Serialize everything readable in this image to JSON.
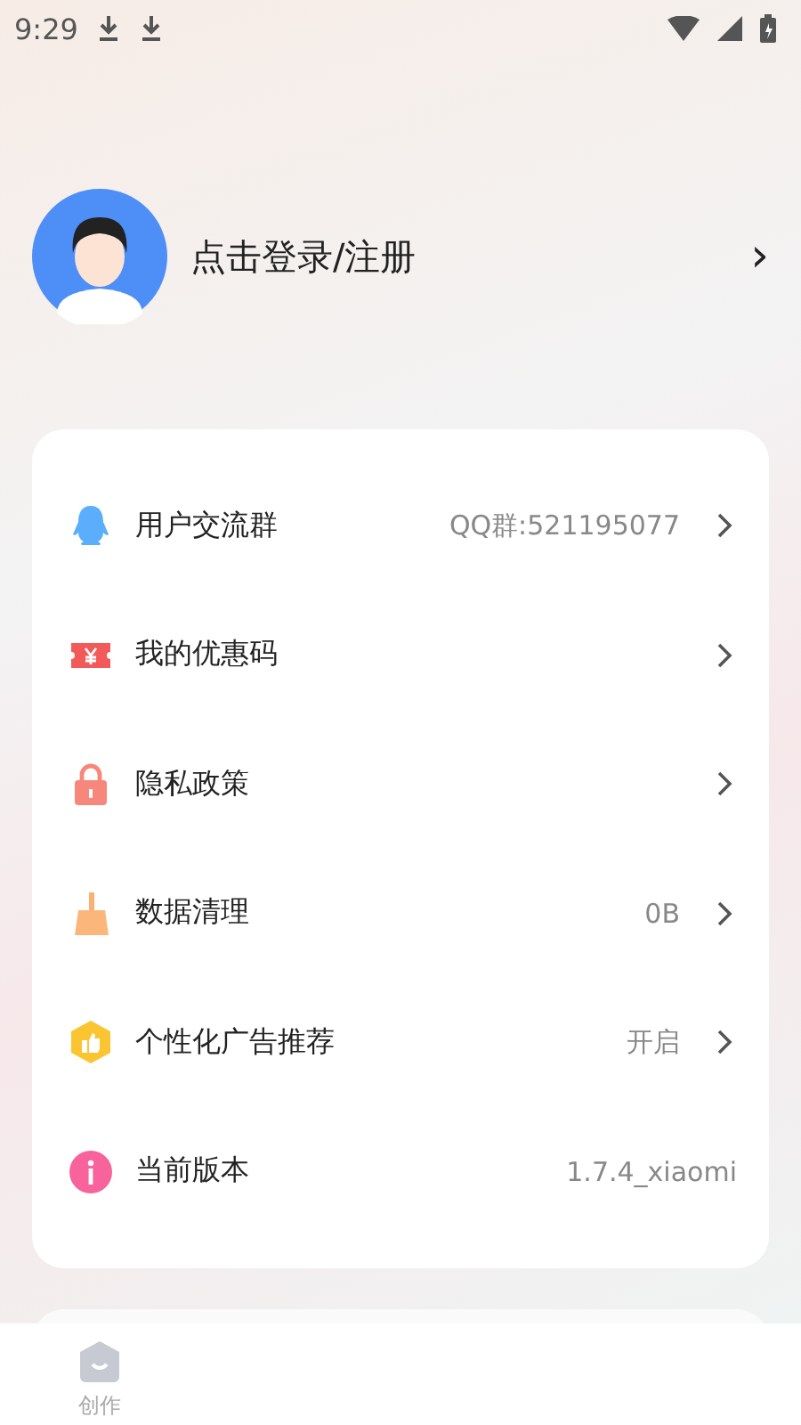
{
  "status_bar": {
    "time": "9:29"
  },
  "profile": {
    "login_label": "点击登录/注册",
    "chevron": "›"
  },
  "menu": [
    {
      "kind": "qq",
      "label": "用户交流群",
      "value": "QQ群:521195077",
      "chevron": true
    },
    {
      "kind": "coupon",
      "label": "我的优惠码",
      "chevron": true
    },
    {
      "kind": "lock",
      "label": "隐私政策",
      "chevron": true
    },
    {
      "kind": "broom",
      "label": "数据清理",
      "value": "0B",
      "chevron": true
    },
    {
      "kind": "ads",
      "label": "个性化广告推荐",
      "value": "开启",
      "chevron": true
    },
    {
      "kind": "info",
      "label": "当前版本",
      "value": "1.7.4_xiaomi",
      "chevron": false
    }
  ],
  "tab_bar": [
    {
      "label": "创作",
      "selected": false
    }
  ]
}
